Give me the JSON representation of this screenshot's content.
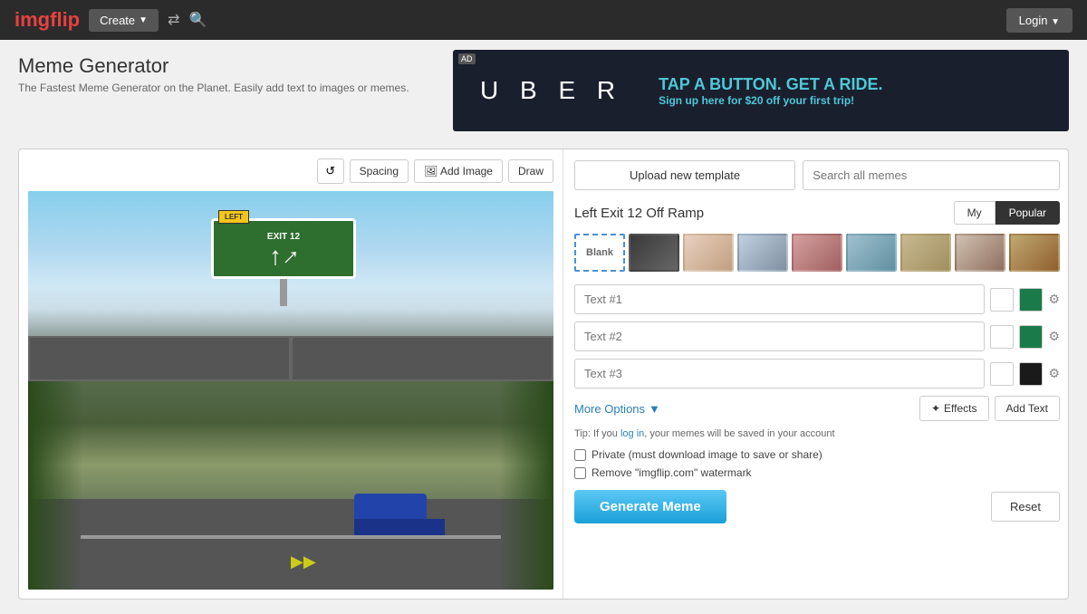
{
  "navbar": {
    "logo_img": "img",
    "logo_flip": "flip",
    "create_label": "Create",
    "login_label": "Login"
  },
  "page": {
    "title": "Meme Generator",
    "subtitle": "The Fastest Meme Generator on the Planet. Easily add text to images or memes."
  },
  "ad": {
    "label": "AD",
    "brand": "U B E R",
    "headline": "TAP A BUTTON. GET A RIDE.",
    "subtext_pre": "Sign up here for ",
    "discount": "$20",
    "subtext_post": " off your first trip!"
  },
  "toolbar": {
    "spacing_label": "Spacing",
    "add_image_label": "Add Image",
    "draw_label": "Draw"
  },
  "right_panel": {
    "upload_label": "Upload new template",
    "search_placeholder": "Search all memes",
    "template_title": "Left Exit 12 Off Ramp",
    "tab_my": "My",
    "tab_popular": "Popular",
    "blank_label": "Blank",
    "text1_placeholder": "Text #1",
    "text2_placeholder": "Text #2",
    "text3_placeholder": "Text #3",
    "more_options": "More Options",
    "effects_label": "Effects",
    "add_text_label": "Add Text",
    "tip_text": "Tip: If you ",
    "tip_link": "log in",
    "tip_text2": ", your memes will be saved in your account",
    "private_label": "Private (must download image to save or share)",
    "watermark_label": "Remove \"imgflip.com\" watermark",
    "generate_label": "Generate Meme",
    "reset_label": "Reset"
  }
}
